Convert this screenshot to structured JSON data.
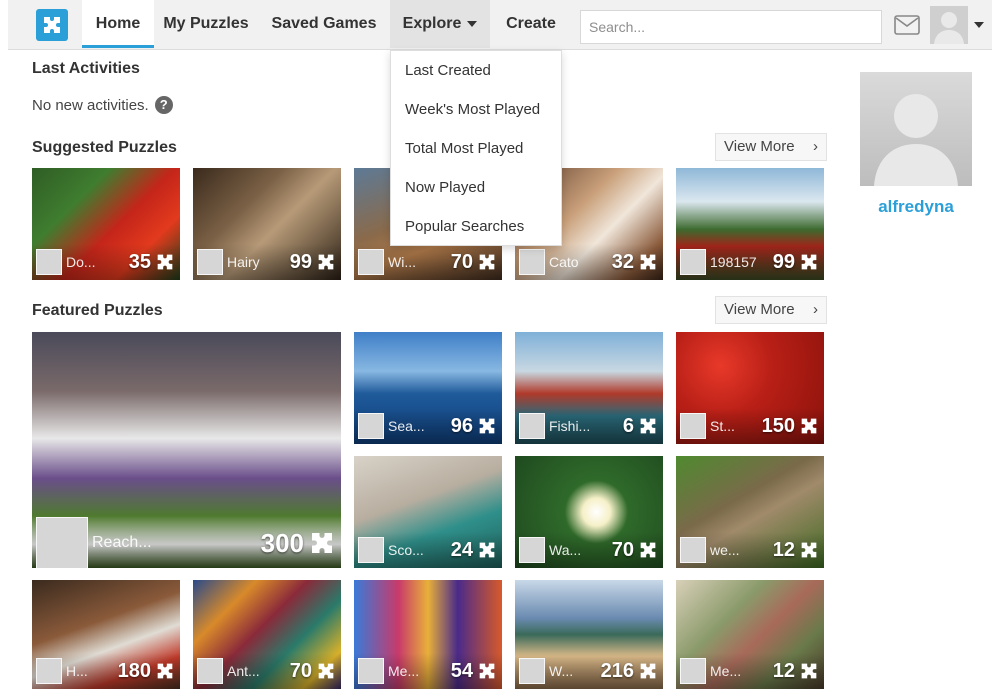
{
  "nav": {
    "home": "Home",
    "my_puzzles": "My Puzzles",
    "saved_games": "Saved Games",
    "explore": "Explore",
    "create": "Create",
    "search_placeholder": "Search..."
  },
  "explore_menu": [
    "Last Created",
    "Week's Most Played",
    "Total Most Played",
    "Now Played",
    "Popular Searches"
  ],
  "last_activities": {
    "title": "Last Activities",
    "empty_text": "No new activities.",
    "help": "?"
  },
  "suggested": {
    "title": "Suggested Puzzles",
    "view_more": "View More",
    "tiles": [
      {
        "user": "Do...",
        "count": "35",
        "theme": "parrot"
      },
      {
        "user": "Hairy",
        "count": "99",
        "theme": "cat"
      },
      {
        "user": "Wi...",
        "count": "70",
        "theme": "city"
      },
      {
        "user": "Cato",
        "count": "32",
        "theme": "kitten"
      },
      {
        "user": "198157",
        "count": "99",
        "theme": "train"
      }
    ]
  },
  "featured": {
    "title": "Featured Puzzles",
    "view_more": "View More",
    "big": {
      "user": "Reach...",
      "count": "300",
      "theme": "horse"
    },
    "tiles": [
      {
        "user": "Sea...",
        "count": "96",
        "theme": "sea"
      },
      {
        "user": "Fishi...",
        "count": "6",
        "theme": "harbor"
      },
      {
        "user": "St...",
        "count": "150",
        "theme": "strawberry"
      },
      {
        "user": "Sco...",
        "count": "24",
        "theme": "rocks"
      },
      {
        "user": "Wa...",
        "count": "70",
        "theme": "lily"
      },
      {
        "user": "we...",
        "count": "12",
        "theme": "wildcat"
      },
      {
        "user": "H...",
        "count": "180",
        "theme": "dog"
      },
      {
        "user": "Ant...",
        "count": "70",
        "theme": "quilt"
      },
      {
        "user": "Me...",
        "count": "54",
        "theme": "market"
      },
      {
        "user": "W...",
        "count": "216",
        "theme": "beach"
      },
      {
        "user": "Me...",
        "count": "12",
        "theme": "soap"
      }
    ]
  },
  "profile": {
    "username": "alfredyna"
  }
}
